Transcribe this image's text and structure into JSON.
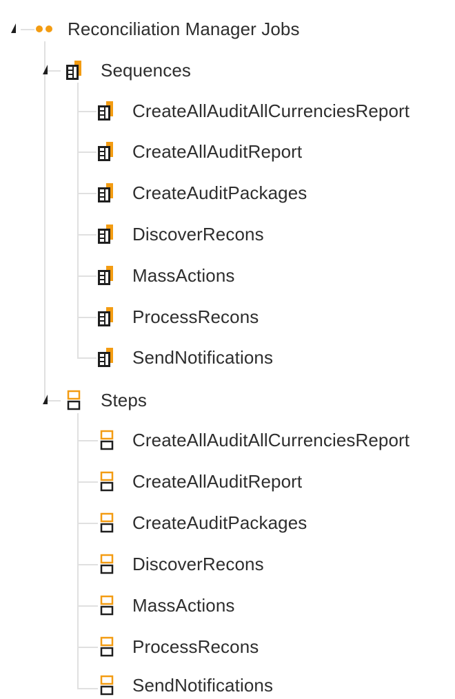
{
  "tree": {
    "root": {
      "label": "Reconciliation Manager Jobs",
      "icon": "dots-icon",
      "expanded": true
    },
    "groups": [
      {
        "label": "Sequences",
        "icon": "sequence-icon",
        "expanded": true,
        "items": [
          "CreateAllAuditAllCurrenciesReport",
          "CreateAllAuditReport",
          "CreateAuditPackages",
          "DiscoverRecons",
          "MassActions",
          "ProcessRecons",
          "SendNotifications"
        ]
      },
      {
        "label": "Steps",
        "icon": "step-icon",
        "expanded": true,
        "items": [
          "CreateAllAuditAllCurrenciesReport",
          "CreateAllAuditReport",
          "CreateAuditPackages",
          "DiscoverRecons",
          "MassActions",
          "ProcessRecons",
          "SendNotifications"
        ]
      }
    ]
  },
  "colors": {
    "accent": "#f39c12",
    "dark": "#1e1e1e",
    "line": "#e0e0e0"
  }
}
